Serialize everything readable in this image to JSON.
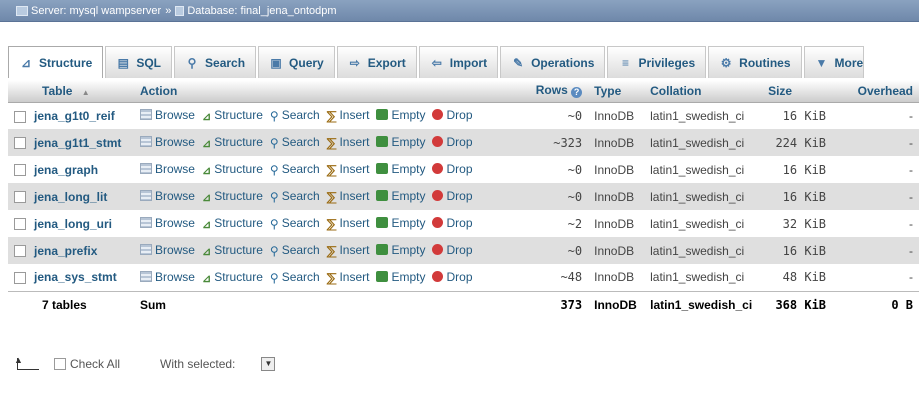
{
  "breadcrumb": {
    "server": "Server: mysql wampserver",
    "separator": "»",
    "database": "Database: final_jena_ontodpm"
  },
  "tabs": [
    {
      "label": "Structure",
      "icon": "structure-icon"
    },
    {
      "label": "SQL",
      "icon": "sql-icon"
    },
    {
      "label": "Search",
      "icon": "search-icon"
    },
    {
      "label": "Query",
      "icon": "query-icon"
    },
    {
      "label": "Export",
      "icon": "export-icon"
    },
    {
      "label": "Import",
      "icon": "import-icon"
    },
    {
      "label": "Operations",
      "icon": "wrench-icon"
    },
    {
      "label": "Privileges",
      "icon": "privileges-icon"
    },
    {
      "label": "Routines",
      "icon": "routines-icon"
    },
    {
      "label": "More",
      "icon": "chevron-down-icon"
    }
  ],
  "table": {
    "headers": {
      "table": "Table",
      "sort_indicator": "▲",
      "action": "Action",
      "rows": "Rows",
      "type": "Type",
      "collation": "Collation",
      "size": "Size",
      "overhead": "Overhead"
    },
    "action_labels": {
      "browse": "Browse",
      "structure": "Structure",
      "search": "Search",
      "insert": "Insert",
      "empty": "Empty",
      "drop": "Drop"
    },
    "rows": [
      {
        "name": "jena_g1t0_reif",
        "rows": "~0",
        "type": "InnoDB",
        "collation": "latin1_swedish_ci",
        "size": "16 KiB",
        "overhead": "-"
      },
      {
        "name": "jena_g1t1_stmt",
        "rows": "~323",
        "type": "InnoDB",
        "collation": "latin1_swedish_ci",
        "size": "224 KiB",
        "overhead": "-"
      },
      {
        "name": "jena_graph",
        "rows": "~0",
        "type": "InnoDB",
        "collation": "latin1_swedish_ci",
        "size": "16 KiB",
        "overhead": "-"
      },
      {
        "name": "jena_long_lit",
        "rows": "~0",
        "type": "InnoDB",
        "collation": "latin1_swedish_ci",
        "size": "16 KiB",
        "overhead": "-"
      },
      {
        "name": "jena_long_uri",
        "rows": "~2",
        "type": "InnoDB",
        "collation": "latin1_swedish_ci",
        "size": "32 KiB",
        "overhead": "-"
      },
      {
        "name": "jena_prefix",
        "rows": "~0",
        "type": "InnoDB",
        "collation": "latin1_swedish_ci",
        "size": "16 KiB",
        "overhead": "-"
      },
      {
        "name": "jena_sys_stmt",
        "rows": "~48",
        "type": "InnoDB",
        "collation": "latin1_swedish_ci",
        "size": "48 KiB",
        "overhead": "-"
      }
    ],
    "summary": {
      "tables": "7 tables",
      "sum": "Sum",
      "rows": "373",
      "type": "InnoDB",
      "collation": "latin1_swedish_ci",
      "size": "368 KiB",
      "overhead": "0 B"
    }
  },
  "footer": {
    "check_all": "Check All",
    "with_selected": "With selected:",
    "dropdown_glyph": "▼"
  }
}
